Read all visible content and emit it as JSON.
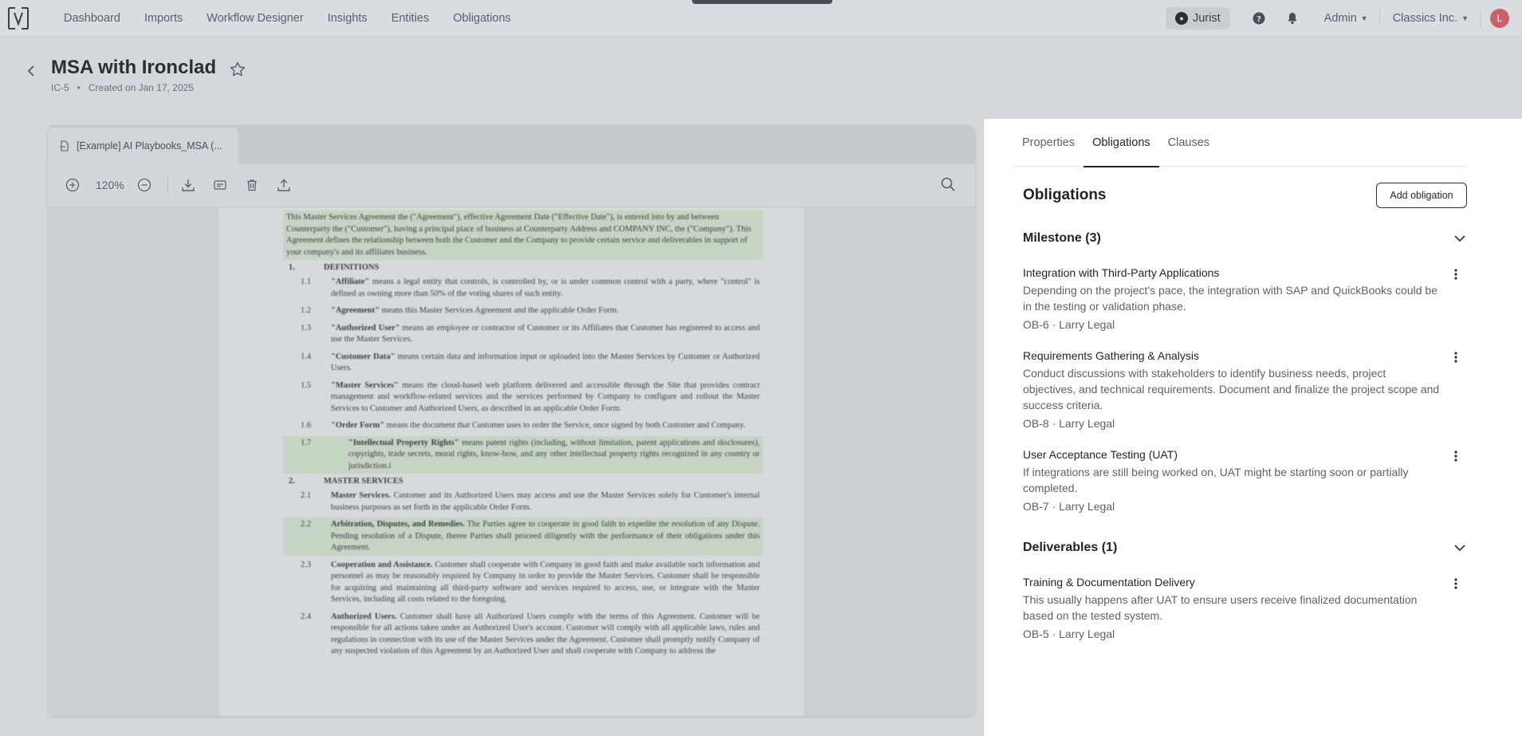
{
  "nav": {
    "items": [
      "Dashboard",
      "Imports",
      "Workflow Designer",
      "Insights",
      "Entities",
      "Obligations"
    ],
    "jurist_label": "Jurist",
    "admin_label": "Admin",
    "org_label": "Classics Inc.",
    "avatar_initial": "L"
  },
  "header": {
    "title": "MSA with Ironclad",
    "id": "IC-5",
    "bullet": "•",
    "created": "Created on Jan 17, 2025"
  },
  "viewer": {
    "tab_label": "[Example] AI Playbooks_MSA (...",
    "zoom": "120%",
    "document": {
      "intro": "This Master Services Agreement the (\"Agreement\"), effective Agreement Date (\"Effective Date\"), is entered into by and between Counterparty the (\"Customer\"), having a principal place of business at Counterparty Address and COMPANY INC, the (\"Company\"). This Agreement defines the relationship between both the Customer and the Company to provide certain service and deliverables in support of your company's and its affiliates business.",
      "s1_num": "1.",
      "s1_title": "DEFINITIONS",
      "s1_items": [
        {
          "n": "1.1",
          "term": "\"Affiliate\"",
          "text": " means a legal entity that controls, is controlled by, or is under common control with a party, where \"control\" is defined as owning more than 50% of the voting shares of such entity."
        },
        {
          "n": "1.2",
          "term": "\"Agreement\"",
          "text": " means this Master Services Agreement and the applicable Order Form."
        },
        {
          "n": "1.3",
          "term": "\"Authorized User\"",
          "text": " means an employee or contractor of Customer or its Affiliates that Customer has registered to access and use the Master Services."
        },
        {
          "n": "1.4",
          "term": "\"Customer Data\"",
          "text": " means certain data and information input or uploaded into the Master Services by Customer or Authorized Users."
        },
        {
          "n": "1.5",
          "term": "\"Master Services\"",
          "text": " means the cloud-based web platform delivered and accessible through the Site that provides contract management and workflow-related services and the services performed by Company to configure and rollout the Master Services to Customer and Authorized Users, as described in an applicable Order Form."
        },
        {
          "n": "1.6",
          "term": "\"Order Form\"",
          "text": " means the document that Customer uses to order the Service, once signed by both Customer and Company."
        },
        {
          "n": "1.7",
          "term": "\"Intellectual Property Rights\"",
          "text": " means patent rights (including, without limitation, patent applications and disclosures), copyrights, trade secrets, moral rights, know-how, and any other intellectual property rights recognized in any country or jurisdiction.i"
        }
      ],
      "s2_num": "2.",
      "s2_title": "MASTER SERVICES",
      "s2_items": [
        {
          "n": "2.1",
          "term": "Master Services.",
          "text": " Customer and its Authorized Users may access and use the Master Services solely for Customer's internal business purposes as set forth in the applicable Order Form."
        },
        {
          "n": "2.2",
          "term": "Arbitration, Disputes, and Remedies.",
          "text": " The Parties agree to cooperate in good faith to expedite the resolution of any Dispute. Pending resolution of a Dispute, theree Parties shall proceed diligently with the performance of their obligations under this Agreement."
        },
        {
          "n": "2.3",
          "term": "Cooperation and Assistance.",
          "text": " Customer shall cooperate with Company in good faith and make available such information and personnel as may be reasonably required by Company in order to provide the Master Services. Customer shall be responsible for acquiring and maintaining all third-party software and services required to access, use, or integrate with the Master Services, including all costs related to the foregoing."
        },
        {
          "n": "2.4",
          "term": "Authorized Users.",
          "text": " Customer shall have all Authorized Users comply with the terms of this Agreement. Customer will be responsible for all actions taken under an Authorized User's account. Customer will comply with all applicable laws, rules and regulations in connection with its use of the Master Services under the Agreement. Customer shall promptly notify Company of any suspected violation of this Agreement by an Authorized User and shall cooperate with Company to address the"
        }
      ]
    }
  },
  "panel": {
    "tabs": [
      "Properties",
      "Obligations",
      "Clauses"
    ],
    "title": "Obligations",
    "add_button": "Add obligation",
    "groups": [
      {
        "title": "Milestone (3)",
        "items": [
          {
            "title": "Integration with Third-Party Applications",
            "desc": "Depending on the project's pace, the integration with SAP and QuickBooks could be in the testing or validation phase.",
            "meta": "OB-6 · Larry Legal"
          },
          {
            "title": "Requirements Gathering & Analysis",
            "desc": "Conduct discussions with stakeholders to identify business needs, project objectives, and technical requirements. Document and finalize the project scope and success criteria.",
            "meta": "OB-8 · Larry Legal"
          },
          {
            "title": "User Acceptance Testing (UAT)",
            "desc": "If integrations are still being worked on, UAT might be starting soon or partially completed.",
            "meta": "OB-7 · Larry Legal"
          }
        ]
      },
      {
        "title": "Deliverables (1)",
        "items": [
          {
            "title": "Training & Documentation Delivery",
            "desc": "This usually happens after UAT to ensure users receive finalized documentation based on the tested system.",
            "meta": "OB-5 · Larry Legal"
          }
        ]
      }
    ]
  }
}
